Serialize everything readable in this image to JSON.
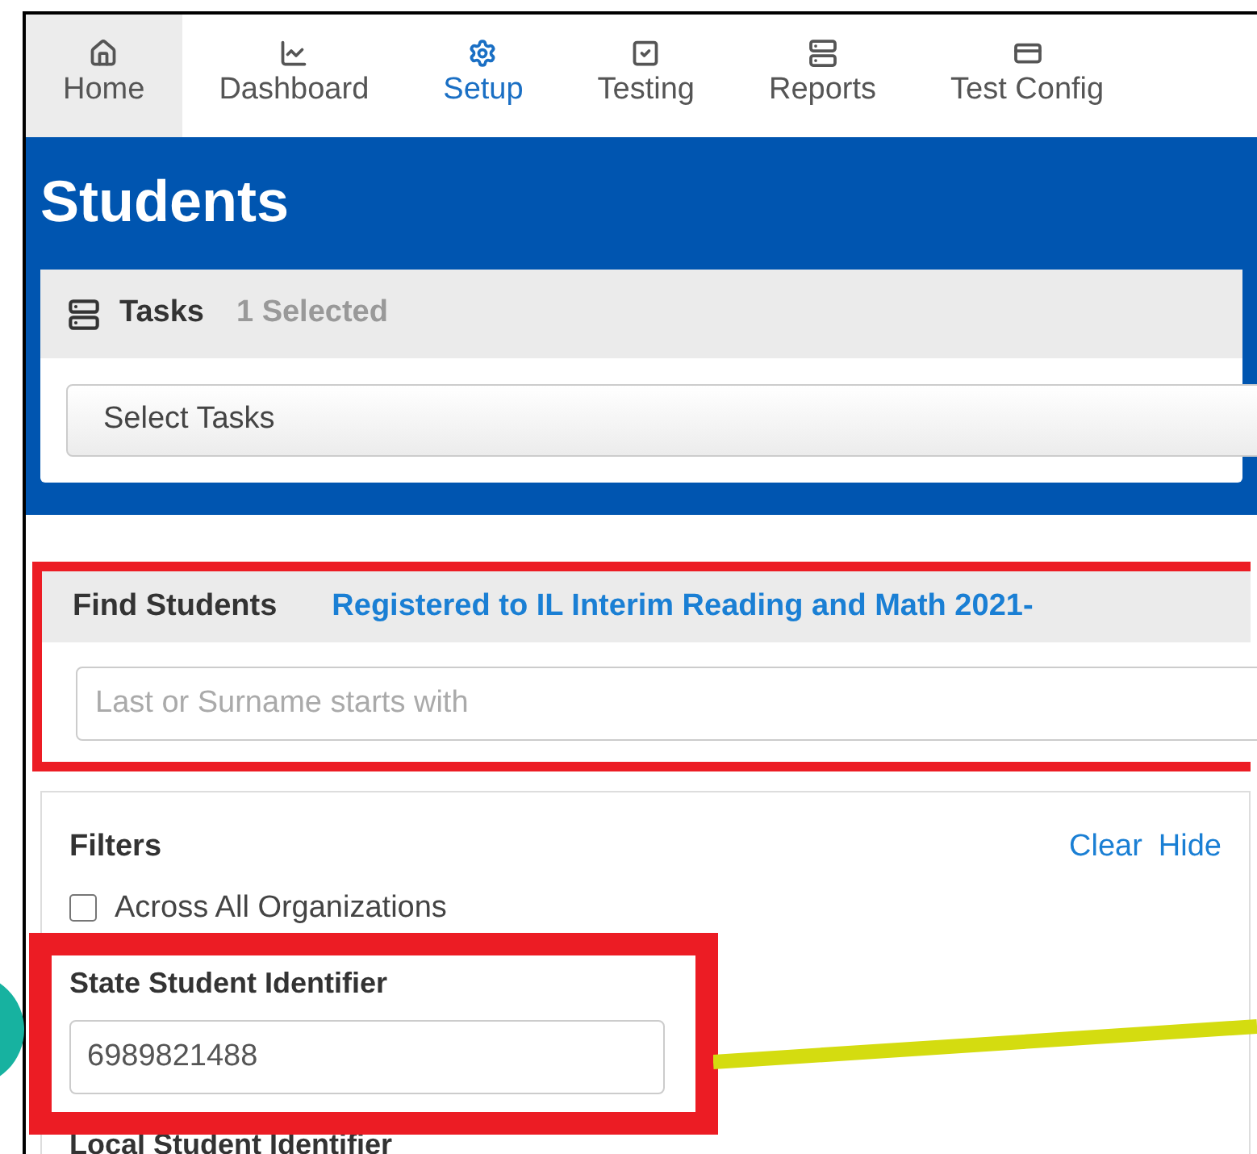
{
  "nav": [
    {
      "label": "Home",
      "selected": false,
      "highlighted": true
    },
    {
      "label": "Dashboard",
      "selected": false,
      "highlighted": false
    },
    {
      "label": "Setup",
      "selected": true,
      "highlighted": false
    },
    {
      "label": "Testing",
      "selected": false,
      "highlighted": false
    },
    {
      "label": "Reports",
      "selected": false,
      "highlighted": false
    },
    {
      "label": "Test Config",
      "selected": false,
      "highlighted": false
    }
  ],
  "page_title": "Students",
  "tasks": {
    "title": "Tasks",
    "count": "1 Selected",
    "select_button": "Select Tasks"
  },
  "find": {
    "title": "Find Students",
    "link": "Registered to IL Interim Reading and Math 2021-",
    "placeholder": "Last or Surname starts with"
  },
  "filters": {
    "title": "Filters",
    "actions": [
      "Clear",
      "Hide"
    ],
    "across_all": {
      "label": "Across All Organizations",
      "checked": false
    },
    "fields": [
      {
        "label": "State Student Identifier",
        "value": "6989821488"
      }
    ],
    "next_label": "Local Student Identifier"
  }
}
